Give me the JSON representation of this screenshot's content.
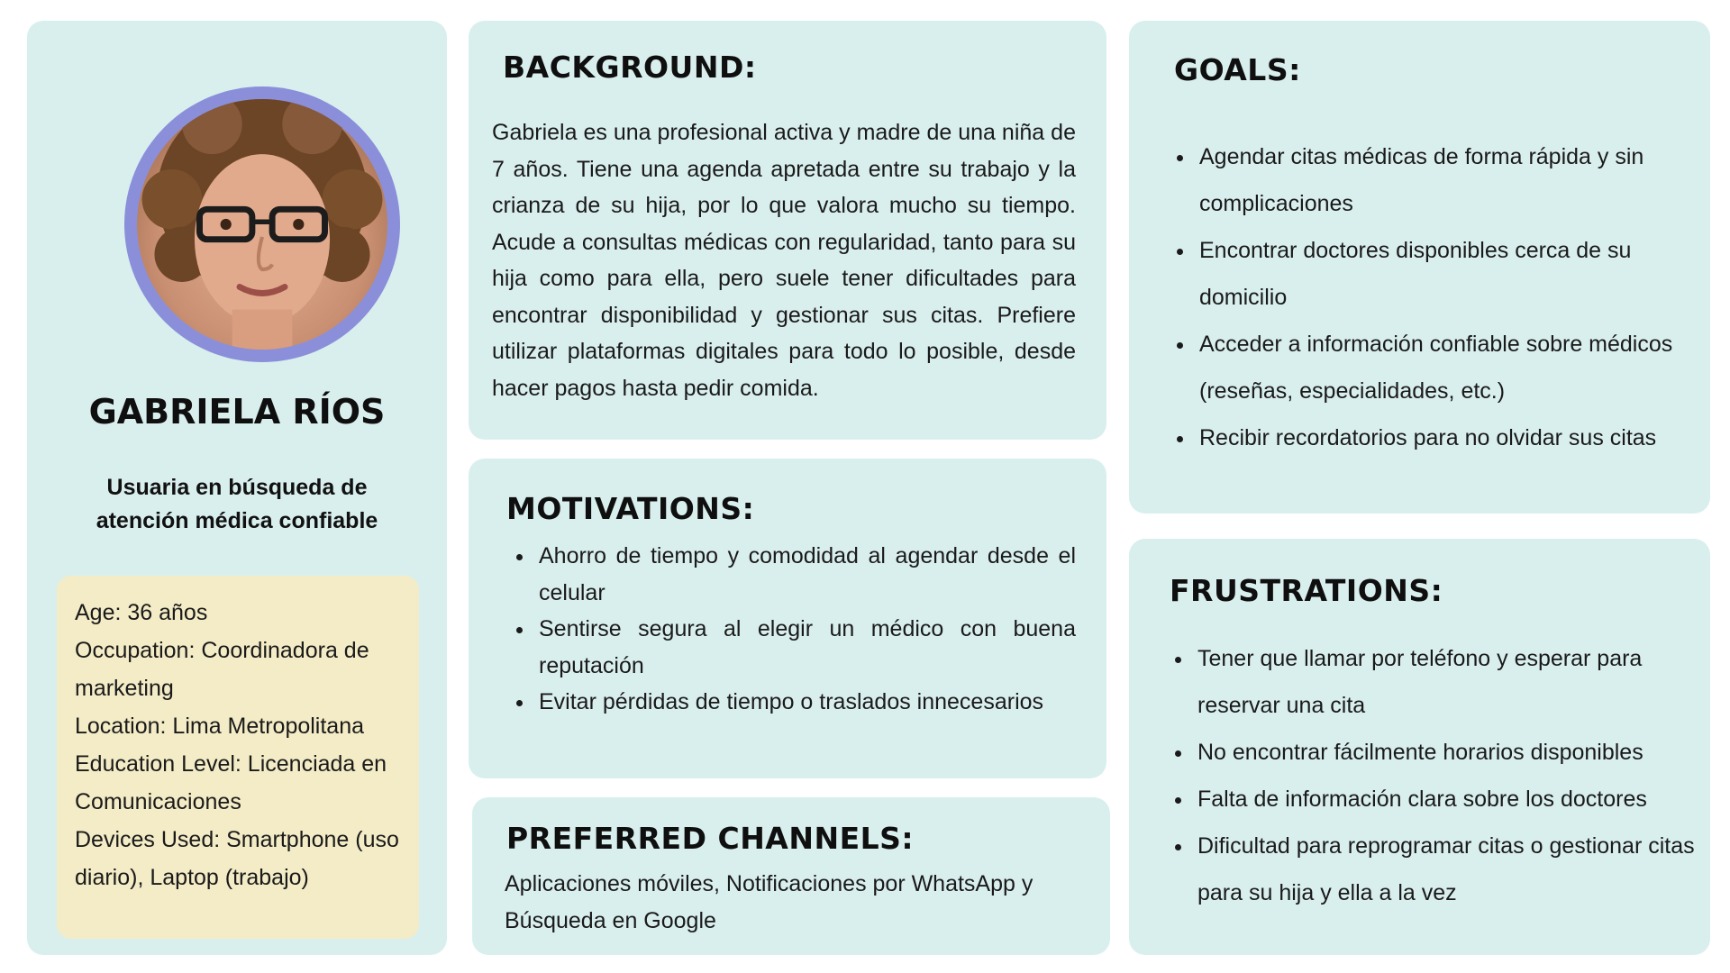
{
  "persona": {
    "name": "GABRIELA RÍOS",
    "tagline": "Usuaria en búsqueda de atención médica confiable",
    "demographics": {
      "age": "Age: 36 años",
      "occupation": "Occupation: Coordinadora de marketing",
      "location": "Location: Lima Metropolitana",
      "education": "Education Level: Licenciada en Comunicaciones",
      "devices": "Devices Used: Smartphone (uso diario), Laptop (trabajo)"
    }
  },
  "background": {
    "heading": "BACKGROUND:",
    "text": "Gabriela es una profesional activa y madre de una niña de 7 años. Tiene una agenda apretada entre su trabajo y la crianza de su hija, por lo que valora mucho su tiempo. Acude a consultas médicas con regularidad, tanto para su hija como para ella, pero suele tener dificultades para encontrar disponibilidad y gestionar sus citas. Prefiere utilizar plataformas digitales para todo lo posible, desde hacer pagos hasta pedir comida."
  },
  "motivations": {
    "heading": "MOTIVATIONS:",
    "items": [
      "Ahorro de tiempo y comodidad al agendar desde el celular",
      "Sentirse segura al elegir un médico con buena reputación",
      "Evitar pérdidas de tiempo o traslados innecesarios"
    ]
  },
  "channels": {
    "heading": "PREFERRED CHANNELS:",
    "text": "Aplicaciones móviles, Notificaciones por WhatsApp y Búsqueda en Google"
  },
  "goals": {
    "heading": "GOALS:",
    "items": [
      "Agendar citas médicas de forma rápida y sin complicaciones",
      "Encontrar doctores disponibles cerca de su domicilio",
      "Acceder a información confiable sobre médicos (reseñas, especialidades, etc.)",
      "Recibir recordatorios para no olvidar sus citas"
    ]
  },
  "frustrations": {
    "heading": "FRUSTRATIONS:",
    "items": [
      "Tener que llamar por teléfono y esperar para reservar una cita",
      "No encontrar fácilmente horarios disponibles",
      "Falta de información clara sobre los doctores",
      "Dificultad para reprogramar citas o gestionar citas para su hija y ella a la vez"
    ]
  },
  "colors": {
    "card_background": "#d9efee",
    "demographics_background": "#f3ecc6",
    "avatar_ring": "#8b8fd9"
  }
}
